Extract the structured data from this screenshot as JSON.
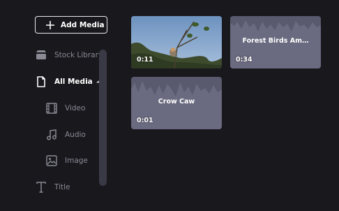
{
  "toolbar": {
    "add_media_label": "Add Media"
  },
  "sidebar": {
    "stock_library": "Stock Library",
    "all_media": "All Media",
    "video": "Video",
    "audio": "Audio",
    "image": "Image",
    "title": "Title"
  },
  "media": [
    {
      "type": "video",
      "title": "",
      "duration": "0:11"
    },
    {
      "type": "audio",
      "title": "Forest Birds Am…",
      "duration": "0:34"
    },
    {
      "type": "audio",
      "title": "Crow Caw",
      "duration": "0:01"
    }
  ],
  "colors": {
    "background": "#19181d",
    "tile": "#5a5a6e",
    "muted_text": "#8a8a94",
    "scrollbar": "#3a3946"
  }
}
